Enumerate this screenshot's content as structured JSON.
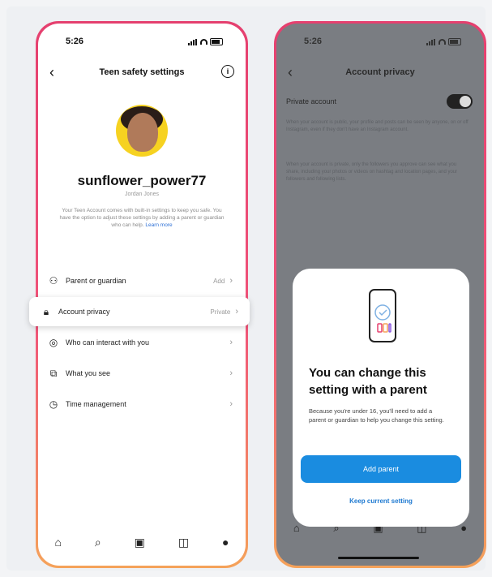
{
  "left_phone": {
    "time": "5:26",
    "header_title": "Teen safety settings",
    "username": "sunflower_power77",
    "subname": "Jordan Jones",
    "description": "Your Teen Account comes with built-in settings to keep you safe. You have the option to adjust these settings by adding a parent or guardian who can help.",
    "learn_more": "Learn more",
    "menu": [
      {
        "label": "Parent or guardian",
        "value": "Add",
        "icon": "people-icon"
      },
      {
        "label": "Account privacy",
        "value": "Private",
        "icon": "lock-icon"
      },
      {
        "label": "Who can interact with you",
        "value": "",
        "icon": "chat-icon"
      },
      {
        "label": "What you see",
        "value": "",
        "icon": "eye-icon"
      },
      {
        "label": "Time management",
        "value": "",
        "icon": "clock-icon"
      }
    ],
    "nav": [
      "home-icon",
      "search-icon",
      "reels-icon",
      "shop-icon",
      "profile-icon"
    ]
  },
  "right_phone": {
    "time": "5:26",
    "header_title": "Account privacy",
    "private_label": "Private account",
    "blur_1": "When your account is public, your profile and posts can be seen by anyone, on or off Instagram, even if they don't have an Instagram account.",
    "blur_2": "When your account is private, only the followers you approve can see what you share, including your photos or videos on hashtag and location pages, and your followers and following lists.",
    "sheet": {
      "heading": "You can change this setting with a parent",
      "body": "Because you're under 16, you'll need to add a parent or guardian to help you change this setting.",
      "button": "Add parent",
      "link": "Keep current setting"
    }
  },
  "colors": {
    "frame_gradient_start": "#e5406f",
    "frame_gradient_end": "#f5a25a",
    "button_blue": "#1a8ce0",
    "overlay_gray": "#7a7d82"
  }
}
